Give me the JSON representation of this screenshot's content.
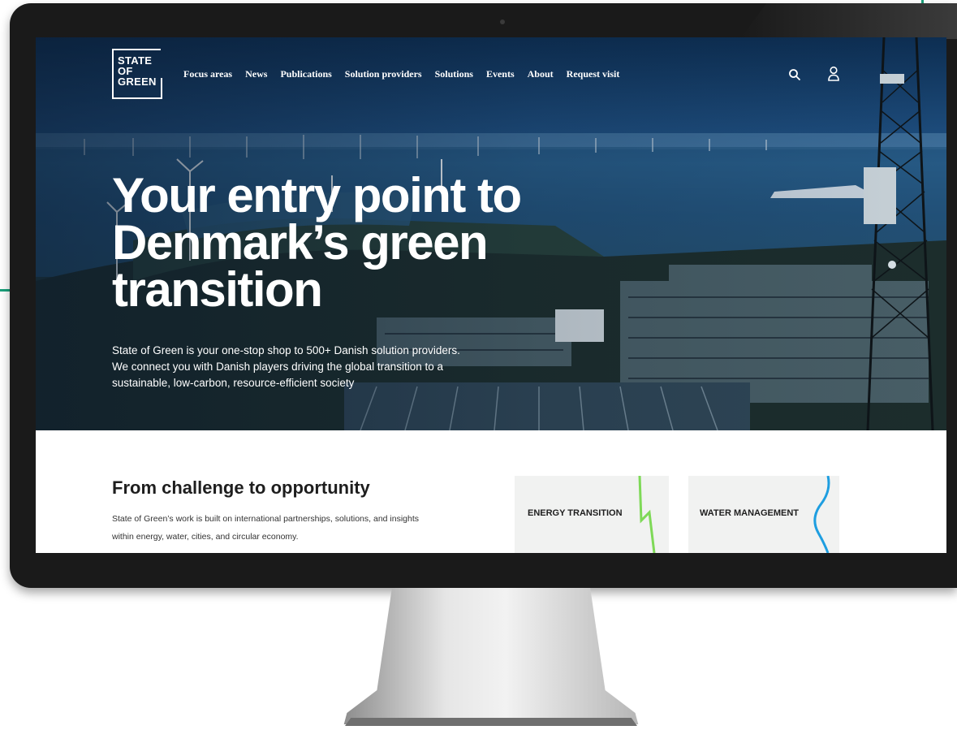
{
  "logo": {
    "lines": [
      "STATE",
      "OF",
      "GREEN"
    ]
  },
  "nav": {
    "items": [
      "Focus areas",
      "News",
      "Publications",
      "Solution providers",
      "Solutions",
      "Events",
      "About",
      "Request visit"
    ],
    "search_icon": "search-icon",
    "user_icon": "user-icon"
  },
  "hero": {
    "headline": "Your entry point to Denmark’s green transition",
    "subtext": "State of Green is your one-stop shop to 500+ Danish solution providers. We connect you with Danish players driving the global transition to a sustainable, low-carbon, resource-efficient society"
  },
  "section": {
    "title": "From challenge to opportunity",
    "text": "State of Green’s work is built on international partnerships, solutions, and insights within energy, water, cities, and circular economy."
  },
  "cards": [
    {
      "label": "ENERGY TRANSITION",
      "accent": "#7ed957"
    },
    {
      "label": "WATER MANAGEMENT",
      "accent": "#1e9ee0"
    }
  ],
  "colors": {
    "brand_green": "#1aa07a"
  }
}
